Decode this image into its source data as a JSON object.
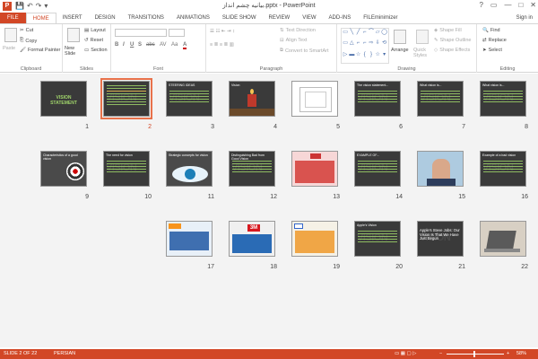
{
  "window": {
    "title": "بیانیه چشم انداز.pptx - PowerPoint",
    "logo": "P",
    "signin": "Sign in"
  },
  "qat": {
    "save": "💾",
    "undo": "↶",
    "redo": "↷",
    "custom": "▾"
  },
  "winbtns": {
    "help": "?",
    "ribbon": "▭",
    "min": "—",
    "max": "□",
    "close": "✕"
  },
  "tabs": [
    "FILE",
    "HOME",
    "INSERT",
    "DESIGN",
    "TRANSITIONS",
    "ANIMATIONS",
    "SLIDE SHOW",
    "REVIEW",
    "VIEW",
    "ADD-INS",
    "FILEminimizer"
  ],
  "ribbon": {
    "clipboard": {
      "label": "Clipboard",
      "paste": "Paste",
      "cut": "Cut",
      "copy": "Copy",
      "format_painter": "Format Painter"
    },
    "slides": {
      "label": "Slides",
      "new_slide": "New Slide",
      "layout": "Layout",
      "reset": "Reset",
      "section": "Section"
    },
    "font": {
      "label": "Font",
      "bold": "B",
      "italic": "I",
      "underline": "U",
      "shadow": "S",
      "strike": "abc",
      "spacing": "AV",
      "case": "Aa",
      "color": "A"
    },
    "paragraph": {
      "label": "Paragraph",
      "text_direction": "Text Direction",
      "align_text": "Align Text",
      "convert": "Convert to SmartArt"
    },
    "drawing": {
      "label": "Drawing",
      "arrange": "Arrange",
      "quick_styles": "Quick Styles",
      "shape_fill": "Shape Fill",
      "shape_outline": "Shape Outline",
      "shape_effects": "Shape Effects"
    },
    "editing": {
      "label": "Editing",
      "find": "Find",
      "replace": "Replace",
      "select": "Select"
    }
  },
  "slides": [
    {
      "num": "8",
      "title": "What vision is...",
      "kind": "vision",
      "selected": false
    },
    {
      "num": "7",
      "title": "What vision is...",
      "kind": "vision",
      "selected": false
    },
    {
      "num": "6",
      "title": "The vision statement...",
      "kind": "vision",
      "selected": false
    },
    {
      "num": "5",
      "title": "",
      "kind": "white",
      "selected": false
    },
    {
      "num": "4",
      "title": "Vision",
      "kind": "candle",
      "selected": false
    },
    {
      "num": "3",
      "title": "STEERING IDEAS",
      "kind": "vision",
      "selected": false
    },
    {
      "num": "2",
      "title": "",
      "kind": "text",
      "selected": true
    },
    {
      "num": "1",
      "title": "VISION STATEMENT",
      "kind": "visiontitle",
      "selected": false
    },
    {
      "num": "16",
      "title": "Example of a bad vision",
      "kind": "vision",
      "selected": false
    },
    {
      "num": "15",
      "title": "",
      "kind": "photo",
      "selected": false
    },
    {
      "num": "14",
      "title": "EXAMPLE OF...",
      "kind": "vision",
      "selected": false
    },
    {
      "num": "13",
      "title": "",
      "kind": "pinktext",
      "selected": false
    },
    {
      "num": "12",
      "title": "Distinguishing Bad from Good Vision",
      "kind": "vision",
      "selected": false
    },
    {
      "num": "11",
      "title": "Strategic concepts for vision",
      "kind": "eye",
      "selected": false
    },
    {
      "num": "10",
      "title": "The need for vision",
      "kind": "vision",
      "selected": false
    },
    {
      "num": "9",
      "title": "Characteristics of a good vision",
      "kind": "target",
      "selected": false
    },
    {
      "num": "22",
      "title": "",
      "kind": "laptop",
      "selected": false
    },
    {
      "num": "21",
      "title": "Apple's Steve Jobs: Our Vision Is That We Have Just Begun",
      "kind": "quote",
      "selected": false
    },
    {
      "num": "20",
      "title": "Apple's Vision",
      "kind": "vision",
      "selected": false
    },
    {
      "num": "19",
      "title": "",
      "kind": "mercedes",
      "selected": false
    },
    {
      "num": "18",
      "title": "3M",
      "kind": "threem",
      "selected": false
    },
    {
      "num": "17",
      "title": "",
      "kind": "blue",
      "selected": false
    }
  ],
  "status": {
    "slide": "SLIDE 2 OF 22",
    "language": "PERSIAN",
    "zoom": "58%",
    "zoom_minus": "−",
    "zoom_plus": "+"
  }
}
